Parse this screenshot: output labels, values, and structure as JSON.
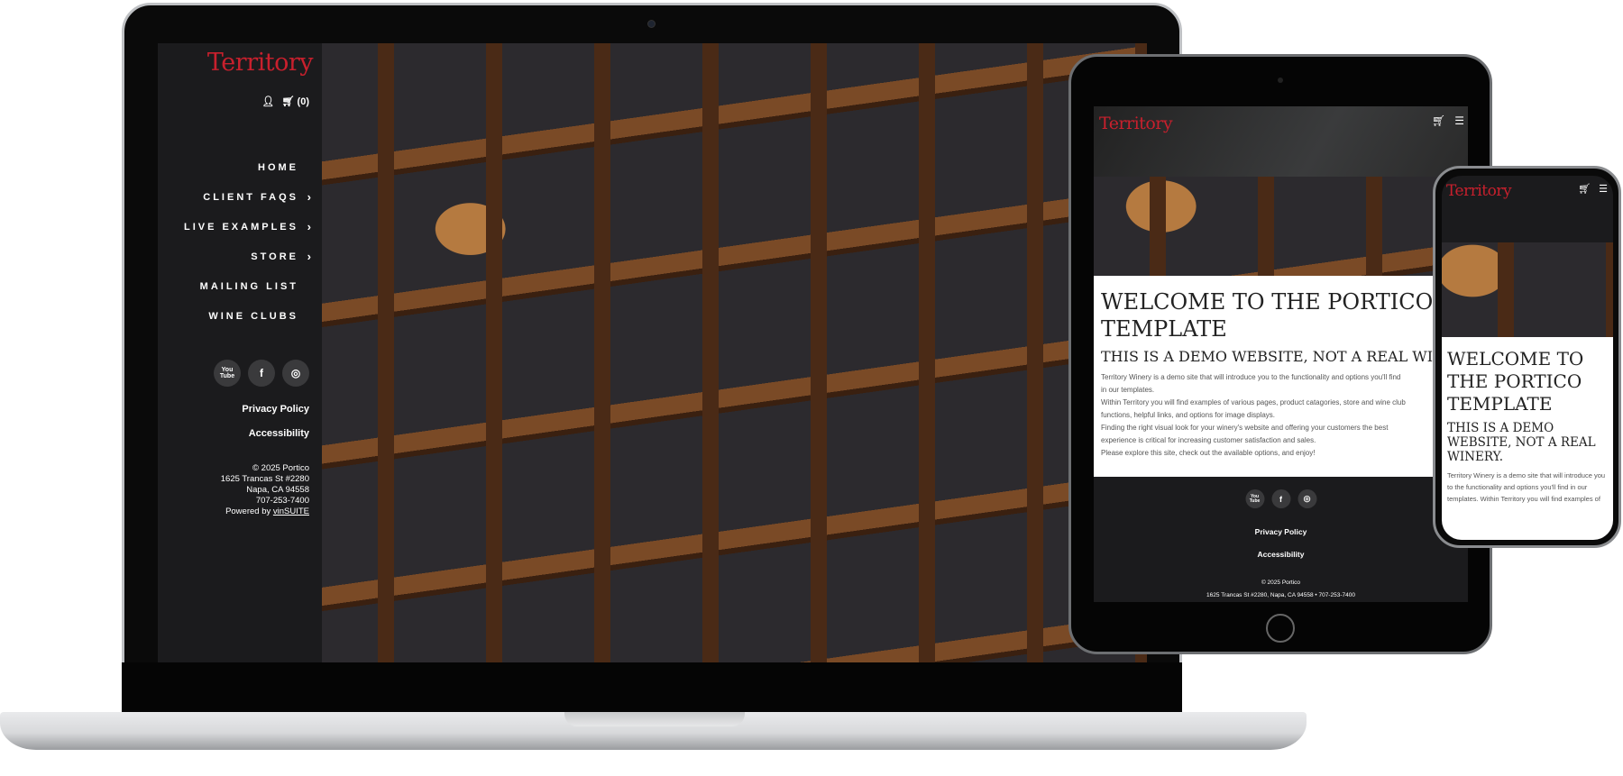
{
  "brand": {
    "name": "Territory",
    "color": "#c8202d"
  },
  "laptop": {
    "utility": {
      "account_icon": "user-icon",
      "cart_icon": "cart-icon",
      "cart_count": "(0)"
    },
    "nav": [
      {
        "label": "HOME",
        "has_submenu": false
      },
      {
        "label": "CLIENT FAQS",
        "has_submenu": true
      },
      {
        "label": "LIVE EXAMPLES",
        "has_submenu": true
      },
      {
        "label": "STORE",
        "has_submenu": true
      },
      {
        "label": "MAILING LIST",
        "has_submenu": false
      },
      {
        "label": "WINE CLUBS",
        "has_submenu": false
      }
    ],
    "social": [
      {
        "name": "youtube-icon",
        "glyph": "You Tube"
      },
      {
        "name": "facebook-icon",
        "glyph": "f"
      },
      {
        "name": "instagram-icon",
        "glyph": "◎"
      }
    ],
    "links": {
      "privacy": "Privacy Policy",
      "accessibility": "Accessibility"
    },
    "footer": {
      "copyright": "© 2025 Portico",
      "address1": "1625 Trancas St #2280",
      "address2": "Napa, CA 94558",
      "phone": "707-253-7400",
      "powered_prefix": "Powered by ",
      "powered_link": "vinSUITE"
    },
    "chevron_glyph": "›"
  },
  "tablet": {
    "icons": {
      "cart": "🛒︎",
      "menu": "☰"
    },
    "heading": "WELCOME TO THE PORTICO TEMPLATE",
    "subheading": "THIS IS A DEMO WEBSITE, NOT A REAL WINERY.",
    "paragraphs": [
      "Territory Winery is a demo site that will introduce you to the functionality and options you'll find",
      "in our templates.",
      "Within Territory you will find examples of various pages, product catagories, store and wine club",
      "functions, helpful links, and options for image displays.",
      "Finding the right visual look for your winery's website and offering your customers the best",
      "experience is critical for increasing customer satisfaction and sales.",
      "Please explore this site, check out the available options, and enjoy!"
    ],
    "social": [
      "You Tube",
      "f",
      "◎"
    ],
    "links": {
      "privacy": "Privacy Policy",
      "accessibility": "Accessibility"
    },
    "footer": {
      "copyright": "© 2025 Portico",
      "address": "1625 Trancas St #2280, Napa, CA 94558 • 707-253-7400"
    }
  },
  "phone": {
    "icons": {
      "cart": "🛒︎",
      "menu": "☰"
    },
    "heading": "WELCOME TO THE PORTICO TEMPLATE",
    "subheading": "THIS IS A DEMO WEBSITE, NOT A REAL WINERY.",
    "paragraph": "Territory Winery is a demo site that will introduce you to the functionality and options you'll find in our templates. Within Territory you will find examples of"
  }
}
